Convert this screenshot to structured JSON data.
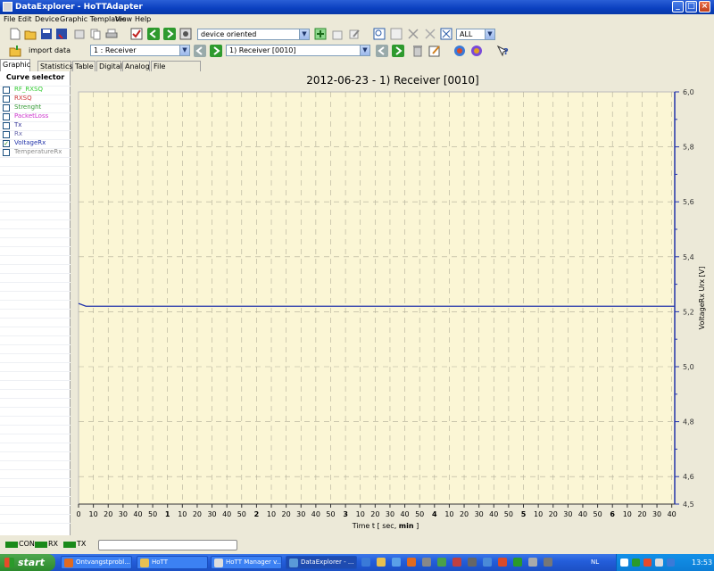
{
  "window": {
    "title": "DataExplorer  -  HoTTAdapter",
    "buttons": [
      "_",
      "□",
      "×"
    ]
  },
  "menu": [
    "File",
    "Edit",
    "Device",
    "Graphic Templates",
    "View",
    "Help"
  ],
  "toolbar": {
    "device_mode": "device oriented",
    "filter": "ALL",
    "import_label": "import data",
    "channel": "1 : Receiver",
    "record": "1) Receiver [0010]"
  },
  "tabs": [
    "Graphic",
    "Statistics",
    "Table",
    "Digital",
    "Analog",
    "File comment"
  ],
  "curve_selector": {
    "title": "Curve selector",
    "items": [
      {
        "label": "RF_RXSQ",
        "color": "#33cc33",
        "checked": false
      },
      {
        "label": "RXSQ",
        "color": "#cc3333",
        "checked": false
      },
      {
        "label": "Strenght",
        "color": "#339933",
        "checked": false
      },
      {
        "label": "PacketLoss",
        "color": "#cc33cc",
        "checked": false
      },
      {
        "label": "Tx",
        "color": "#333399",
        "checked": false
      },
      {
        "label": "Rx",
        "color": "#6666aa",
        "checked": false
      },
      {
        "label": "VoltageRx",
        "color": "#2233aa",
        "checked": true
      },
      {
        "label": "TemperatureRx",
        "color": "#888888",
        "checked": false
      }
    ]
  },
  "chart_data": {
    "type": "line",
    "title": "2012-06-23 - 1) Receiver [0010]",
    "xlabel_prefix": "Time  t  [ sec, ",
    "xlabel_unit": "min",
    "xlabel_suffix": " ]",
    "ylabel": "VoltageRx  Urx  [V]",
    "ylim": [
      4.5,
      6.0
    ],
    "yticks": [
      "6,0",
      "5,8",
      "5,6",
      "5,4",
      "5,2",
      "5,0",
      "4,8",
      "4,6",
      "4,5"
    ],
    "ytick_values": [
      6.0,
      5.8,
      5.6,
      5.4,
      5.2,
      5.0,
      4.8,
      4.6,
      4.5
    ],
    "minor_ytick_values": [
      5.9,
      5.7,
      5.5,
      5.3,
      5.1,
      4.9,
      4.7
    ],
    "xticks": [
      "0",
      "10",
      "20",
      "30",
      "40",
      "50",
      "1",
      "10",
      "20",
      "30",
      "40",
      "50",
      "2",
      "10",
      "20",
      "30",
      "40",
      "50",
      "3",
      "10",
      "20",
      "30",
      "40",
      "50",
      "4",
      "10",
      "20",
      "30",
      "40",
      "50",
      "5",
      "10",
      "20",
      "30",
      "40",
      "50",
      "6",
      "10",
      "20",
      "30",
      "40"
    ],
    "major_xtick_labels": [
      "1",
      "2",
      "3",
      "4",
      "5",
      "6"
    ],
    "xlim_sec": [
      0,
      402
    ],
    "series": [
      {
        "name": "VoltageRx",
        "color": "#2233aa",
        "x": [
          0,
          5,
          402
        ],
        "y": [
          5.23,
          5.22,
          5.22
        ]
      }
    ],
    "background": "#fbf6d5",
    "grid": true
  },
  "statusbar": {
    "indicators": [
      "CON",
      "RX",
      "TX"
    ],
    "indicator_color": "#1a8a1a"
  },
  "taskbar": {
    "start": "start",
    "tasks": [
      {
        "label": "Ontvangstprobl...",
        "icon_color": "#e06a20",
        "active": false
      },
      {
        "label": "HoTT",
        "icon_color": "#e8c050",
        "active": false
      },
      {
        "label": "HoTT Manager v...",
        "icon_color": "#dddddd",
        "active": false
      },
      {
        "label": "DataExplorer - ...",
        "icon_color": "#5a9ad8",
        "active": true
      }
    ],
    "lang": "NL",
    "clock": "13:53"
  }
}
